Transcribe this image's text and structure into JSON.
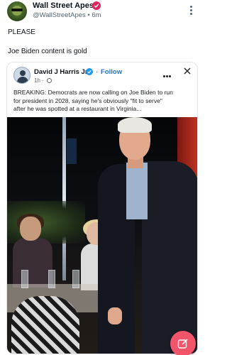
{
  "post": {
    "author_name": "Wall Street Apes",
    "handle_line": "@WallStreetApes • 6m",
    "lines": [
      "PLEASE",
      "Joe Biden content is gold"
    ]
  },
  "quote": {
    "author_name": "David J Harris Jr.",
    "dot": "·",
    "follow_label": "Follow",
    "time": "1h",
    "text_lines": [
      "BREAKING: Democrats are now calling on Joe Biden to run",
      "for president in 2028, saying he's obviously \"fit to serve\"",
      "after he was spotted at a restaurant in Virginia..."
    ]
  },
  "icons": {
    "verified_badge": "verified-badge-icon",
    "more": "more-vertical-icon",
    "close": "close-icon",
    "compose": "compose-icon"
  },
  "colors": {
    "verified_pink": "#e0245e",
    "follow_blue": "#1d74d0",
    "fab": "#f2546a"
  }
}
